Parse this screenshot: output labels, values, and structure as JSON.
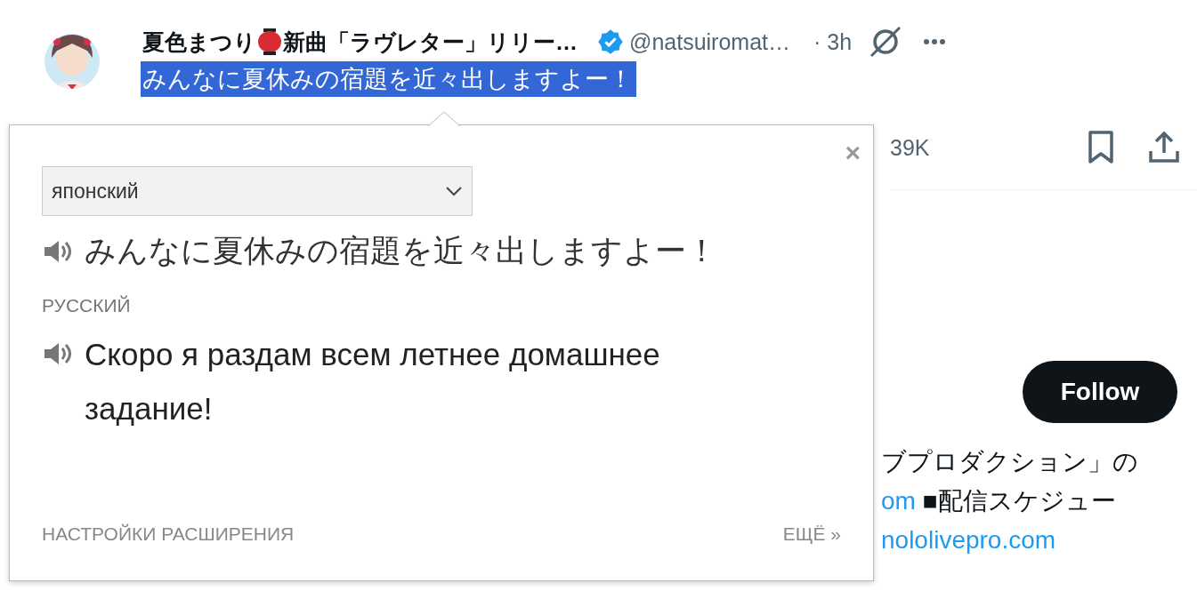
{
  "tweet": {
    "author_name": [
      "夏色まつり",
      "新曲「ラヴレター」リリー…"
    ],
    "verified": true,
    "handle": "@natsuiromat…",
    "time": "· 3h",
    "text": "みんなに夏休みの宿題を近々出しますよー！",
    "text_selected": true,
    "views": "39K"
  },
  "profile": {
    "follow_button": "Follow",
    "bio_lines": [
      [
        {
          "text": "ブプロダクション」の",
          "link": false
        }
      ],
      [
        {
          "text": "om",
          "link": true
        },
        {
          "text": " ■配信スケジュー",
          "link": false
        }
      ],
      [
        {
          "text": "nololivepro.com",
          "link": true
        }
      ]
    ]
  },
  "translator": {
    "close": "×",
    "source_language": "японский",
    "source_text": "みんなに夏休みの宿題を近々出しますよー！",
    "target_language_label": "РУССКИЙ",
    "translation": "Скоро я раздам всем летнее домашнее задание!",
    "settings_link": "НАСТРОЙКИ РАСШИРЕНИЯ",
    "more_link": "ЕЩЁ »"
  }
}
